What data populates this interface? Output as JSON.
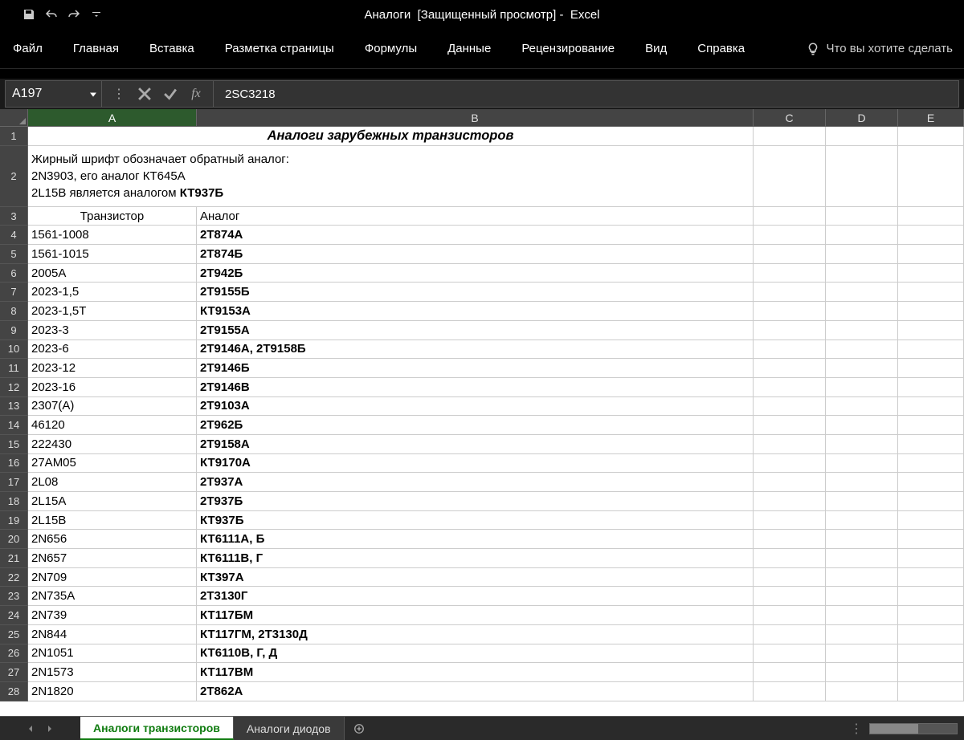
{
  "title": {
    "doc": "Аналоги",
    "mode": "[Защищенный просмотр]",
    "app": "Excel"
  },
  "ribbon": {
    "file": "Файл",
    "home": "Главная",
    "insert": "Вставка",
    "layout": "Разметка страницы",
    "formulas": "Формулы",
    "data": "Данные",
    "review": "Рецензирование",
    "view": "Вид",
    "help": "Справка",
    "tellme": "Что вы хотите сделать"
  },
  "namebox": "A197",
  "formula": "2SC3218",
  "columns": [
    "A",
    "B",
    "C",
    "D",
    "E"
  ],
  "doc_title": "Аналоги зарубежных транзисторов",
  "note_lines": [
    "Жирный шрифт обозначает обратный аналог:",
    "2N3903, его аналог КТ645А",
    "2L15B является аналогом "
  ],
  "note_bold_tail": "КТ937Б",
  "headers": {
    "a": "Транзистор",
    "b": "Аналог"
  },
  "rows": [
    {
      "n": 4,
      "a": "1561-1008",
      "b": "2Т874А"
    },
    {
      "n": 5,
      "a": "1561-1015",
      "b": "2Т874Б"
    },
    {
      "n": 6,
      "a": "2005A",
      "b": "2Т942Б"
    },
    {
      "n": 7,
      "a": "2023-1,5",
      "b": "2Т9155Б"
    },
    {
      "n": 8,
      "a": "2023-1,5T",
      "b": "КТ9153А"
    },
    {
      "n": 9,
      "a": "2023-3",
      "b": "2Т9155А"
    },
    {
      "n": 10,
      "a": "2023-6",
      "b": "2Т9146А, 2Т9158Б"
    },
    {
      "n": 11,
      "a": "2023-12",
      "b": "2Т9146Б"
    },
    {
      "n": 12,
      "a": "2023-16",
      "b": "2Т9146В"
    },
    {
      "n": 13,
      "a": "2307(A)",
      "b": "2Т9103А"
    },
    {
      "n": 14,
      "a": "46120",
      "b": "2Т962Б"
    },
    {
      "n": 15,
      "a": "222430",
      "b": "2Т9158А"
    },
    {
      "n": 16,
      "a": "27AM05",
      "b": "КТ9170А"
    },
    {
      "n": 17,
      "a": "2L08",
      "b": "2Т937А"
    },
    {
      "n": 18,
      "a": "2L15A",
      "b": "2Т937Б"
    },
    {
      "n": 19,
      "a": "2L15B",
      "b": "КТ937Б"
    },
    {
      "n": 20,
      "a": "2N656",
      "b": "КТ6111А, Б"
    },
    {
      "n": 21,
      "a": "2N657",
      "b": "КТ6111В, Г"
    },
    {
      "n": 22,
      "a": "2N709",
      "b": "КТ397А"
    },
    {
      "n": 23,
      "a": "2N735A",
      "b": "2Т3130Г"
    },
    {
      "n": 24,
      "a": "2N739",
      "b": "КТ117БМ"
    },
    {
      "n": 25,
      "a": "2N844",
      "b": "КТ117ГМ, 2Т3130Д"
    },
    {
      "n": 26,
      "a": "2N1051",
      "b": "КТ6110В, Г, Д"
    },
    {
      "n": 27,
      "a": "2N1573",
      "b": "КТ117ВМ"
    },
    {
      "n": 28,
      "a": "2N1820",
      "b": "2Т862А"
    }
  ],
  "sheets": {
    "active": "Аналоги транзисторов",
    "other": "Аналоги диодов"
  }
}
